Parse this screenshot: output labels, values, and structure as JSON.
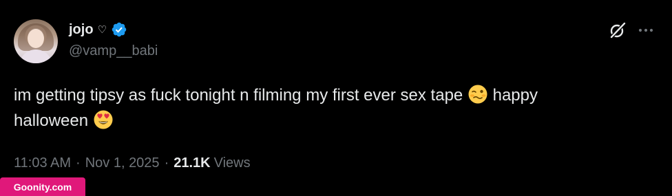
{
  "user": {
    "display_name": "jojo",
    "name_symbol": "♡",
    "handle": "@vamp__babi",
    "verified": true
  },
  "tweet": {
    "text_part1": "im getting tipsy as fuck tonight n filming my first ever sex tape",
    "emoji1": "woozy-face",
    "text_part2": "happy",
    "text_part3": "halloween",
    "emoji2": "smiling-face-with-heart-eyes"
  },
  "meta": {
    "time": "11:03 AM",
    "separator1": "·",
    "date": "Nov 1, 2025",
    "separator2": "·",
    "views_count": "21.1K",
    "views_label": "Views"
  },
  "actions": {
    "grok_icon": "grok-icon",
    "more_icon": "more-icon"
  },
  "watermark": {
    "text": "Goonity.com"
  },
  "colors": {
    "background": "#000000",
    "text_primary": "#e7e9ea",
    "text_secondary": "#71767b",
    "verified_blue": "#1d9bf0",
    "watermark_bg": "#e0187a"
  }
}
